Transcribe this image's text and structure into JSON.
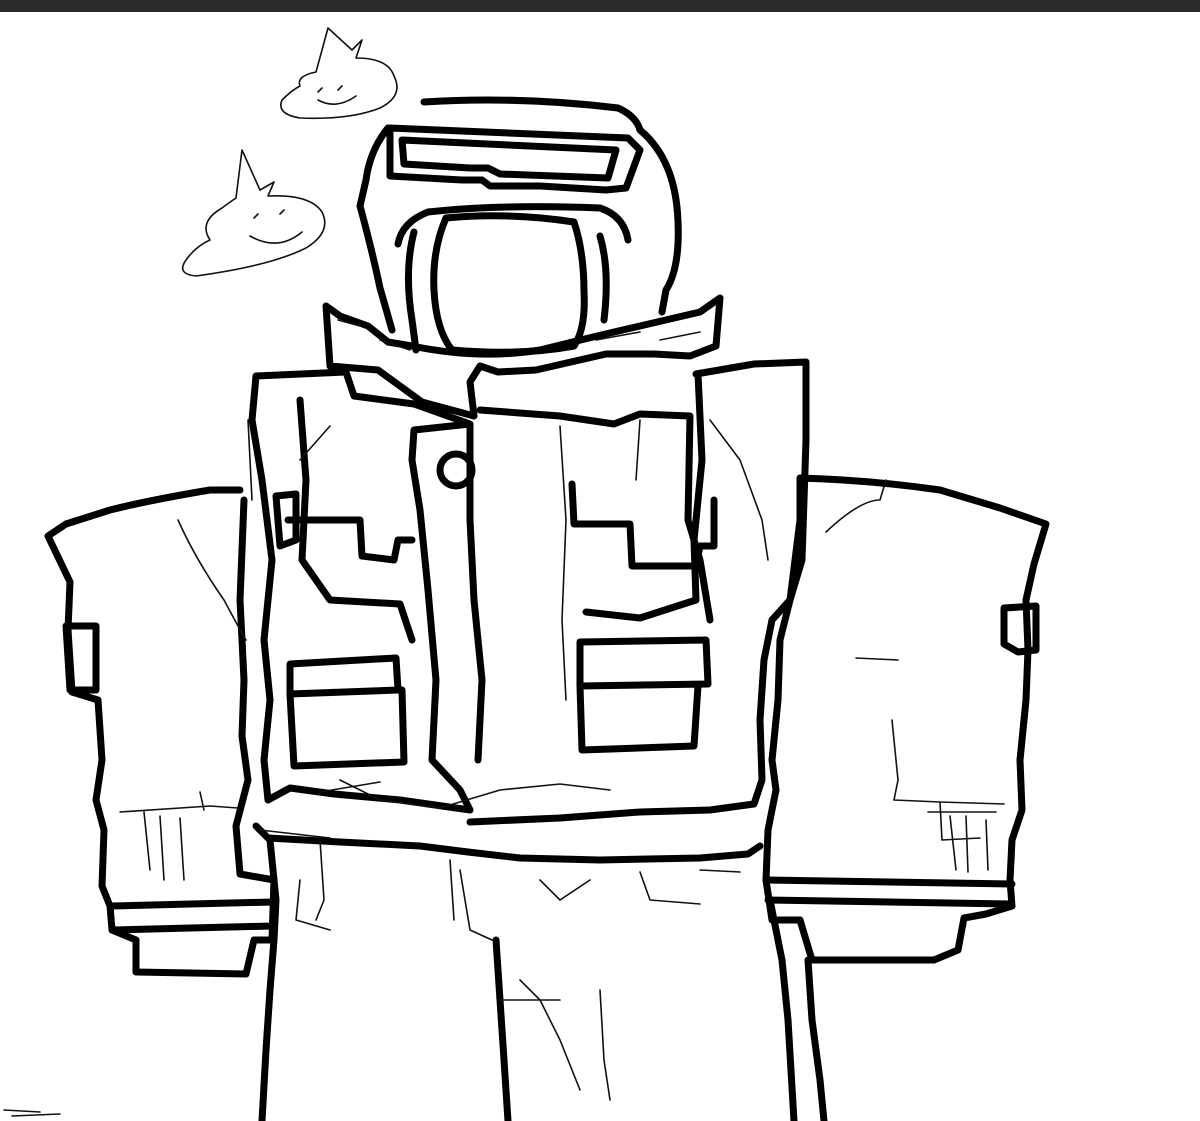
{
  "window": {
    "top_bar_color": "#2b2b2b"
  },
  "canvas": {
    "background": "#ffffff",
    "ink_color": "#000000",
    "content": "line-art-sketch"
  }
}
